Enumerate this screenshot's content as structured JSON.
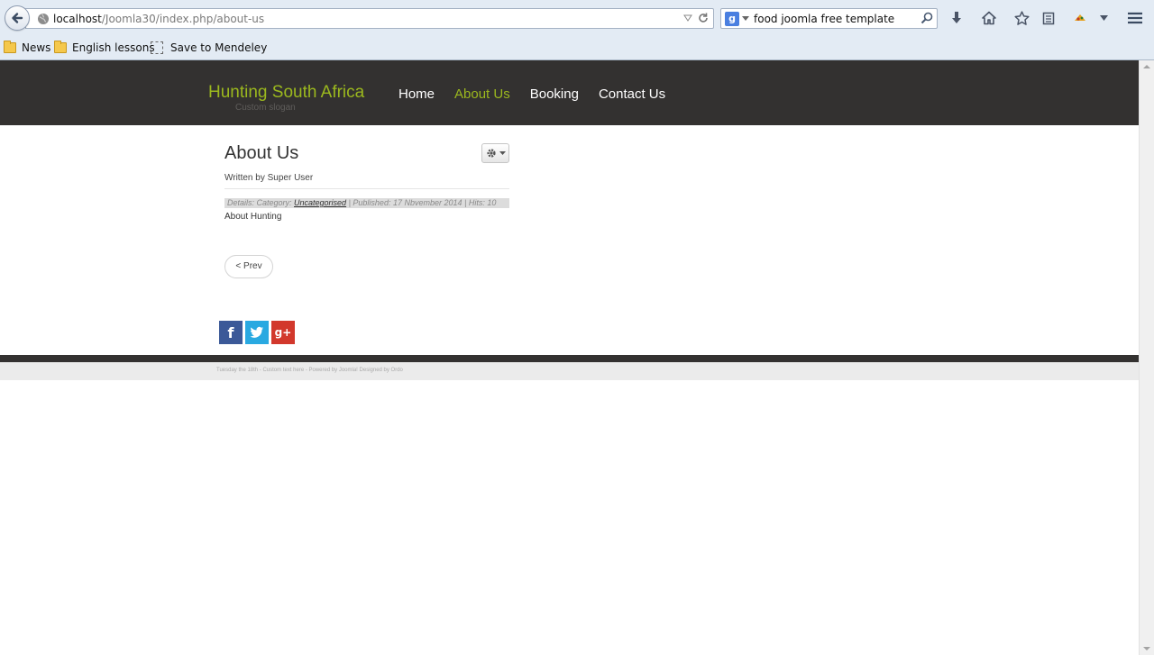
{
  "browser": {
    "url_host": "localhost",
    "url_path": "/Joomla30/index.php/about-us",
    "search_engine_glyph": "g",
    "search_query": "food joomla free template",
    "bookmarks": [
      {
        "label": "News",
        "icon": "folder-icon"
      },
      {
        "label": "English lessons",
        "icon": "folder-icon"
      },
      {
        "label": "Save to Mendeley",
        "icon": "bookmark-icon"
      }
    ]
  },
  "site": {
    "logo": "Hunting South Africa",
    "slogan": "Custom slogan",
    "menu": [
      {
        "label": "Home",
        "active": false
      },
      {
        "label": "About Us",
        "active": true
      },
      {
        "label": "Booking",
        "active": false
      },
      {
        "label": "Contact Us",
        "active": false
      }
    ],
    "accent_color": "#9bb81e",
    "header_color": "#333130"
  },
  "article": {
    "title": "About Us",
    "written_by": "Written by Super User",
    "details_prefix": "Details:  Category: ",
    "category": "Uncategorised",
    "published": " | Published: 17 Nbvember 2014 | Hits: 10",
    "body": "About Hunting",
    "prev_label": "< Prev"
  },
  "social": {
    "facebook_glyph": "f",
    "googleplus_glyph": "g+"
  },
  "footer": {
    "text": "Tuesday the 18th - Custom text here - Powered by Joomla! Designed by Ordo"
  }
}
